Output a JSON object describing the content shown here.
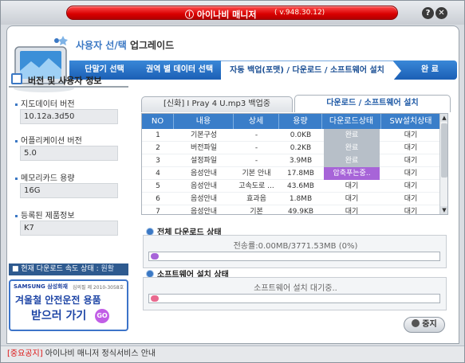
{
  "window": {
    "logo": "ⓘ 아이나비 매니저",
    "version": "( v.948.30.12)",
    "help_icon": "?",
    "close_icon": "✕"
  },
  "header": {
    "title_main": "사용자 선/택",
    "title_sub": " 업그레이드"
  },
  "steps": [
    {
      "label": "단말기 선택"
    },
    {
      "label": "권역 별 데이터 선택"
    },
    {
      "label": "자동 백업(포맷) / 다운로드 / 소프트웨어 설치"
    },
    {
      "label": "완 료"
    }
  ],
  "left_panel": {
    "heading": "버전 및 사용자 정보",
    "fields": [
      {
        "label": "지도데이터 버전",
        "value": "10.12a.3d50"
      },
      {
        "label": "어플리케이션 버전",
        "value": "5.0"
      },
      {
        "label": "메모리카드 용량",
        "value": "16G"
      },
      {
        "label": "등록된 제품정보",
        "value": "K7"
      }
    ],
    "speed_label": "■ 현재 다운로드 속도 상태 : ",
    "speed_value": "원활"
  },
  "ad": {
    "brand": "SAMSUNG 삼성화재",
    "license": "심의필 제 2010-3058호",
    "line1": "겨울철 안전운전 용품",
    "line2": "받으러 가기",
    "go": "GO"
  },
  "tabs": [
    {
      "label": "[신화] I Pray 4 U.mp3 백업중"
    },
    {
      "label": "다운로드 / 소프트웨어 설치"
    }
  ],
  "table": {
    "headers": [
      "NO",
      "내용",
      "상세",
      "용량",
      "다운로드상태",
      "SW설치상태"
    ],
    "rows": [
      {
        "no": "1",
        "content": "기본구성",
        "detail": "-",
        "size": "0.0KB",
        "dl": "완료",
        "sw": "대기"
      },
      {
        "no": "2",
        "content": "버전파일",
        "detail": "-",
        "size": "0.2KB",
        "dl": "완료",
        "sw": "대기"
      },
      {
        "no": "3",
        "content": "설정파일",
        "detail": "-",
        "size": "3.9MB",
        "dl": "완료",
        "sw": "대기"
      },
      {
        "no": "4",
        "content": "음성안내",
        "detail": "기본 안내",
        "size": "17.8MB",
        "dl": "압축푸는중..",
        "sw": "대기"
      },
      {
        "no": "5",
        "content": "음성안내",
        "detail": "고속도로 ...",
        "size": "43.6MB",
        "dl": "대기",
        "sw": "대기"
      },
      {
        "no": "6",
        "content": "음성안내",
        "detail": "효과음",
        "size": "1.8MB",
        "dl": "대기",
        "sw": "대기"
      },
      {
        "no": "7",
        "content": "음성안내",
        "detail": "기본",
        "size": "49.9KB",
        "dl": "대기",
        "sw": "대기"
      }
    ]
  },
  "overall": {
    "label": "전체 다운로드 상태",
    "text": "전송률:0.00MB/3771.53MB (0%)",
    "progress": 0
  },
  "install": {
    "label": "소프트웨어 설치 상태",
    "text": "소프트웨어 설치 대기중..",
    "progress": 0
  },
  "stop_button": "중지",
  "notice": {
    "tag": "[중요공지]",
    "text": " 아이나비 매니저 정식서비스 안내"
  },
  "colors": {
    "accent": "#3a7ec9",
    "title_red": "#d90000",
    "progress_purple": "#a764d8"
  }
}
